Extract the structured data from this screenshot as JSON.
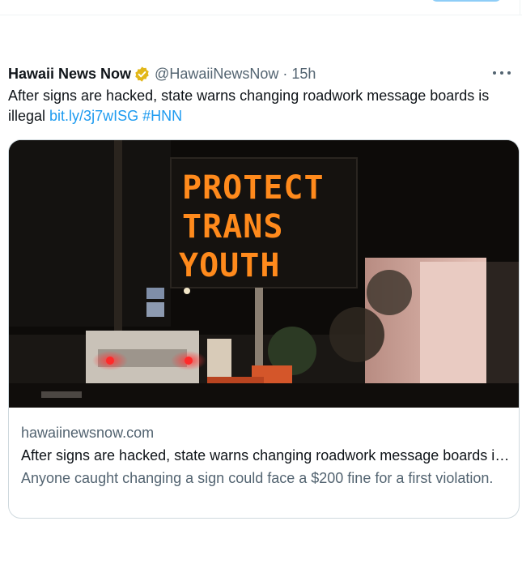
{
  "tweet": {
    "author_name": "Hawaii News Now",
    "author_handle": "@HawaiiNewsNow",
    "separator": "·",
    "time": "15h",
    "text": "After signs are hacked, state warns changing roadwork message boards is illegal",
    "link": "bit.ly/3j7wISG",
    "hashtag": "#HNN",
    "verified_badge_color": "#e2b719",
    "more_icon": "more-horizontal-icon"
  },
  "card": {
    "domain": "hawaiinewsnow.com",
    "title": "After signs are hacked, state warns changing roadwork message boards is illegal",
    "description": "Anyone caught changing a sign could face a $200 fine for a first violation.",
    "image": {
      "sign_lines": [
        "PROTECT",
        "TRANS",
        "YOUTH"
      ],
      "sign_color": "#ff8a1c"
    }
  },
  "colors": {
    "link": "#1d9bf0",
    "secondary_text": "#536471",
    "border": "#cfd9de"
  }
}
